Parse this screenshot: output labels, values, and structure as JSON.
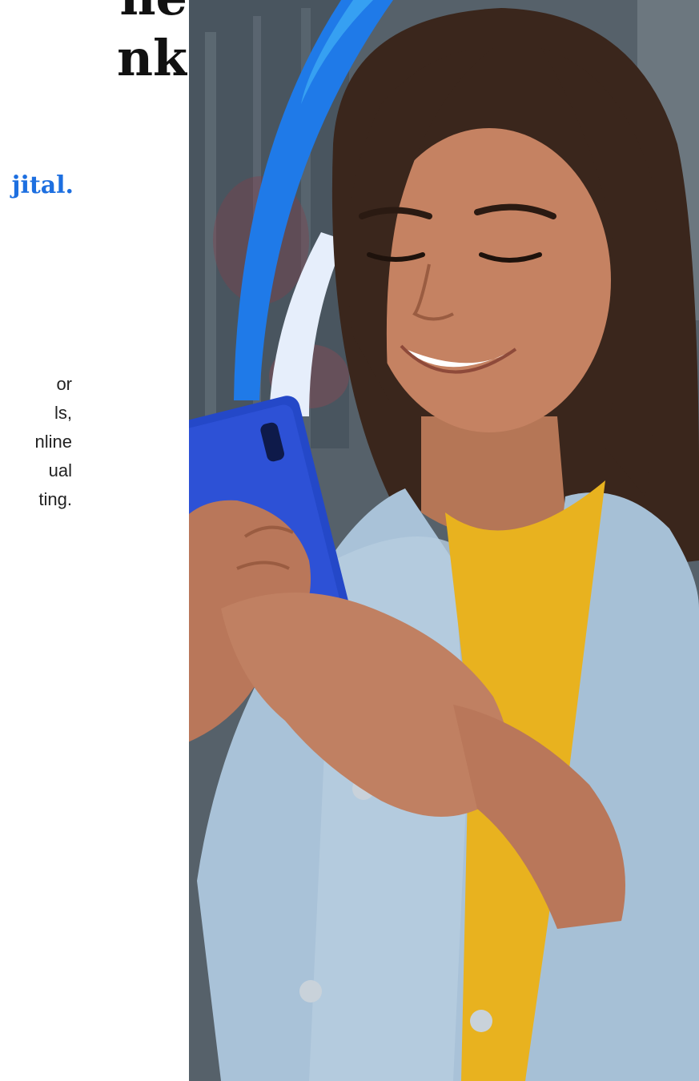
{
  "hero": {
    "headline_line1": "ne",
    "headline_line2": "nk",
    "tagline": "jital.",
    "body_lines": [
      "or",
      "ls,",
      "nline",
      "ual",
      "ting."
    ]
  },
  "colors": {
    "accent_blue": "#1d6fe0",
    "swoosh_blue": "#1f7ae8",
    "headline_text": "#111111",
    "body_text": "#222222",
    "jacket_denim": "#a9c2d8",
    "shirt_yellow": "#e8b21f",
    "phone_blue": "#2448c8"
  }
}
